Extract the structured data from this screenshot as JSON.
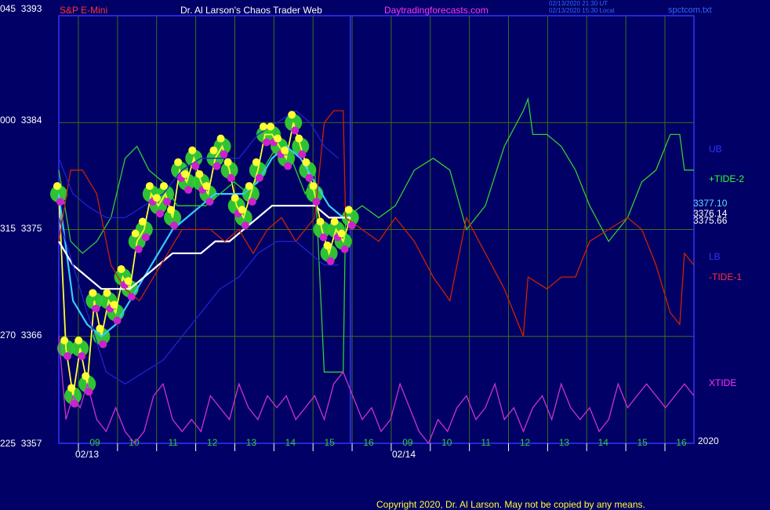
{
  "header": {
    "instrument": "S&P E-Mini",
    "title": "Dr. Al Larson's Chaos Trader Web",
    "site": "Daytradingforecasts.com",
    "stamp1": "02/13/2020 21:30 UT",
    "stamp2": "02/13/2020 15:30 Local",
    "file": "spctcom.txt"
  },
  "colors": {
    "background": "#000066",
    "grid": "#3c6e1e",
    "frame": "#3333ff",
    "price": "#ffff33",
    "ema_fast": "#33ccff",
    "ema_slow": "#ffffff",
    "tide_plus": "#33cc33",
    "tide_minus": "#cc2200",
    "xtide": "#cc33cc",
    "ub": "#2222cc",
    "lb": "#2222cc"
  },
  "right_labels": {
    "ub": "UB",
    "tide2": "+TIDE-2",
    "lb": "LB",
    "tide1": "-TIDE-1",
    "xtide": "XTIDE",
    "v1": "3377.10",
    "v2": "3376.14",
    "v3": "3375.66",
    "year": "2020"
  },
  "footer": {
    "copyright": "Copyright 2020, Dr. Al Larson. May not be copied by any means."
  },
  "chart_data": {
    "type": "line",
    "title": "S&P E-Mini",
    "y_ticks": [
      {
        "left": "045",
        "value": "3393"
      },
      {
        "left": "000",
        "value": "3384"
      },
      {
        "left": "315",
        "value": "3375"
      },
      {
        "left": "270",
        "value": "3366"
      },
      {
        "left": "225",
        "value": "3357"
      }
    ],
    "ylim": [
      3357,
      3393
    ],
    "x_ticks": [
      "09",
      "10",
      "11",
      "12",
      "13",
      "14",
      "15",
      "16",
      "09",
      "10",
      "11",
      "12",
      "13",
      "14",
      "15",
      "16"
    ],
    "date_labels": [
      "02/13",
      "02/14"
    ],
    "series": [
      {
        "name": "price",
        "color": "#ffff33",
        "points": [
          [
            0,
            3378
          ],
          [
            3,
            3365
          ],
          [
            6,
            3361
          ],
          [
            9,
            3365
          ],
          [
            12,
            3362
          ],
          [
            15,
            3369
          ],
          [
            18,
            3366
          ],
          [
            21,
            3369
          ],
          [
            24,
            3368
          ],
          [
            27,
            3371
          ],
          [
            30,
            3370
          ],
          [
            33,
            3374
          ],
          [
            36,
            3375
          ],
          [
            39,
            3378
          ],
          [
            42,
            3377
          ],
          [
            45,
            3378
          ],
          [
            48,
            3376
          ],
          [
            51,
            3380
          ],
          [
            54,
            3379
          ],
          [
            57,
            3381
          ],
          [
            60,
            3379
          ],
          [
            63,
            3378
          ],
          [
            66,
            3381
          ],
          [
            69,
            3382
          ],
          [
            72,
            3380
          ],
          [
            75,
            3377
          ],
          [
            78,
            3376
          ],
          [
            81,
            3378
          ],
          [
            84,
            3380
          ],
          [
            87,
            3383
          ],
          [
            90,
            3383
          ],
          [
            93,
            3382
          ],
          [
            96,
            3381
          ],
          [
            99,
            3384
          ],
          [
            102,
            3382
          ],
          [
            105,
            3380
          ],
          [
            108,
            3378
          ],
          [
            111,
            3375
          ],
          [
            114,
            3373
          ],
          [
            117,
            3375
          ],
          [
            120,
            3374
          ],
          [
            123,
            3376
          ]
        ]
      },
      {
        "name": "ema-fast",
        "color": "#33ccff",
        "points": [
          [
            0,
            3378
          ],
          [
            6,
            3369
          ],
          [
            12,
            3367
          ],
          [
            18,
            3366
          ],
          [
            24,
            3367
          ],
          [
            30,
            3369
          ],
          [
            36,
            3371
          ],
          [
            42,
            3373
          ],
          [
            48,
            3375
          ],
          [
            54,
            3376
          ],
          [
            60,
            3377
          ],
          [
            66,
            3378
          ],
          [
            72,
            3378
          ],
          [
            78,
            3378
          ],
          [
            84,
            3379
          ],
          [
            90,
            3381
          ],
          [
            96,
            3382
          ],
          [
            102,
            3381
          ],
          [
            108,
            3379
          ],
          [
            114,
            3377
          ],
          [
            120,
            3376
          ],
          [
            123,
            3376
          ]
        ]
      },
      {
        "name": "ema-slow",
        "color": "#ffffff",
        "points": [
          [
            0,
            3374
          ],
          [
            6,
            3372
          ],
          [
            12,
            3371
          ],
          [
            18,
            3370
          ],
          [
            24,
            3370
          ],
          [
            30,
            3370
          ],
          [
            36,
            3371
          ],
          [
            42,
            3372
          ],
          [
            48,
            3373
          ],
          [
            54,
            3373
          ],
          [
            60,
            3373
          ],
          [
            66,
            3374
          ],
          [
            72,
            3374
          ],
          [
            78,
            3375
          ],
          [
            84,
            3376
          ],
          [
            90,
            3377
          ],
          [
            96,
            3377
          ],
          [
            102,
            3377
          ],
          [
            108,
            3377
          ],
          [
            114,
            3376
          ],
          [
            120,
            3376
          ],
          [
            123,
            3376
          ]
        ]
      },
      {
        "name": "+TIDE-2",
        "color": "#33cc33",
        "points": [
          [
            0,
            3380
          ],
          [
            5,
            3374
          ],
          [
            10,
            3373
          ],
          [
            16,
            3374
          ],
          [
            22,
            3376
          ],
          [
            28,
            3381
          ],
          [
            33,
            3382
          ],
          [
            38,
            3380
          ],
          [
            44,
            3379
          ],
          [
            50,
            3377
          ],
          [
            56,
            3377
          ],
          [
            62,
            3377
          ],
          [
            68,
            3378
          ],
          [
            74,
            3379
          ],
          [
            80,
            3378
          ],
          [
            86,
            3380
          ],
          [
            92,
            3382
          ],
          [
            98,
            3381
          ],
          [
            104,
            3378
          ],
          [
            108,
            3380
          ],
          [
            112,
            3363
          ],
          [
            120,
            3363
          ],
          [
            121,
            3376
          ],
          [
            128,
            3377
          ],
          [
            135,
            3376
          ],
          [
            142,
            3377
          ],
          [
            150,
            3380
          ],
          [
            158,
            3381
          ],
          [
            165,
            3380
          ],
          [
            172,
            3375
          ],
          [
            180,
            3377
          ],
          [
            188,
            3382
          ],
          [
            196,
            3385
          ],
          [
            198,
            3386
          ],
          [
            200,
            3383
          ],
          [
            206,
            3383
          ],
          [
            212,
            3382
          ],
          [
            218,
            3380
          ],
          [
            224,
            3377
          ],
          [
            232,
            3374
          ],
          [
            240,
            3376
          ],
          [
            246,
            3379
          ],
          [
            252,
            3380
          ],
          [
            258,
            3383
          ],
          [
            262,
            3383
          ],
          [
            264,
            3380
          ],
          [
            268,
            3380
          ]
        ]
      },
      {
        "name": "-TIDE-1",
        "color": "#cc2200",
        "points": [
          [
            0,
            3374
          ],
          [
            5,
            3380
          ],
          [
            10,
            3380
          ],
          [
            16,
            3378
          ],
          [
            22,
            3372
          ],
          [
            28,
            3370
          ],
          [
            34,
            3369
          ],
          [
            40,
            3371
          ],
          [
            46,
            3373
          ],
          [
            52,
            3375
          ],
          [
            58,
            3375
          ],
          [
            64,
            3375
          ],
          [
            70,
            3374
          ],
          [
            76,
            3375
          ],
          [
            82,
            3373
          ],
          [
            88,
            3375
          ],
          [
            94,
            3376
          ],
          [
            100,
            3374
          ],
          [
            104,
            3375
          ],
          [
            108,
            3376
          ],
          [
            112,
            3384
          ],
          [
            116,
            3385
          ],
          [
            120,
            3385
          ],
          [
            121,
            3376
          ],
          [
            128,
            3375
          ],
          [
            135,
            3374
          ],
          [
            142,
            3376
          ],
          [
            150,
            3374
          ],
          [
            158,
            3371
          ],
          [
            165,
            3369
          ],
          [
            172,
            3376
          ],
          [
            180,
            3373
          ],
          [
            188,
            3370
          ],
          [
            196,
            3366
          ],
          [
            198,
            3371
          ],
          [
            206,
            3370
          ],
          [
            212,
            3371
          ],
          [
            218,
            3371
          ],
          [
            224,
            3374
          ],
          [
            232,
            3375
          ],
          [
            240,
            3376
          ],
          [
            246,
            3375
          ],
          [
            252,
            3372
          ],
          [
            258,
            3368
          ],
          [
            262,
            3367
          ],
          [
            264,
            3373
          ],
          [
            268,
            3372
          ]
        ]
      },
      {
        "name": "UB",
        "color": "#2222cc",
        "points": [
          [
            0,
            3381
          ],
          [
            6,
            3378
          ],
          [
            12,
            3377
          ],
          [
            20,
            3376
          ],
          [
            28,
            3376
          ],
          [
            36,
            3377
          ],
          [
            44,
            3378
          ],
          [
            52,
            3380
          ],
          [
            60,
            3381
          ],
          [
            68,
            3381
          ],
          [
            76,
            3381
          ],
          [
            84,
            3383
          ],
          [
            92,
            3384
          ],
          [
            100,
            3385
          ],
          [
            106,
            3384
          ],
          [
            112,
            3382
          ],
          [
            118,
            3381
          ]
        ]
      },
      {
        "name": "LB",
        "color": "#2222cc",
        "points": [
          [
            0,
            3376
          ],
          [
            6,
            3372
          ],
          [
            12,
            3368
          ],
          [
            20,
            3363
          ],
          [
            28,
            3362
          ],
          [
            36,
            3363
          ],
          [
            44,
            3364
          ],
          [
            52,
            3366
          ],
          [
            60,
            3368
          ],
          [
            68,
            3370
          ],
          [
            76,
            3371
          ],
          [
            84,
            3373
          ],
          [
            92,
            3374
          ],
          [
            100,
            3374
          ],
          [
            106,
            3373
          ],
          [
            112,
            3372
          ],
          [
            118,
            3372
          ]
        ]
      },
      {
        "name": "XTIDE",
        "color": "#cc33cc",
        "points": [
          [
            0,
            3366
          ],
          [
            3,
            3359
          ],
          [
            6,
            3361
          ],
          [
            9,
            3360
          ],
          [
            12,
            3362
          ],
          [
            16,
            3359
          ],
          [
            20,
            3358
          ],
          [
            24,
            3360
          ],
          [
            28,
            3358
          ],
          [
            32,
            3357
          ],
          [
            36,
            3358
          ],
          [
            40,
            3361
          ],
          [
            44,
            3362
          ],
          [
            48,
            3359
          ],
          [
            52,
            3358
          ],
          [
            56,
            3359
          ],
          [
            60,
            3358
          ],
          [
            64,
            3361
          ],
          [
            68,
            3360
          ],
          [
            72,
            3359
          ],
          [
            76,
            3362
          ],
          [
            80,
            3360
          ],
          [
            84,
            3359
          ],
          [
            88,
            3361
          ],
          [
            92,
            3360
          ],
          [
            96,
            3361
          ],
          [
            100,
            3359
          ],
          [
            104,
            3360
          ],
          [
            108,
            3361
          ],
          [
            112,
            3359
          ],
          [
            116,
            3362
          ],
          [
            120,
            3363
          ],
          [
            124,
            3361
          ],
          [
            128,
            3359
          ],
          [
            132,
            3360
          ],
          [
            136,
            3358
          ],
          [
            140,
            3359
          ],
          [
            144,
            3362
          ],
          [
            148,
            3360
          ],
          [
            152,
            3358
          ],
          [
            156,
            3357
          ],
          [
            160,
            3359
          ],
          [
            164,
            3358
          ],
          [
            168,
            3360
          ],
          [
            172,
            3361
          ],
          [
            176,
            3359
          ],
          [
            180,
            3360
          ],
          [
            184,
            3362
          ],
          [
            188,
            3359
          ],
          [
            192,
            3360
          ],
          [
            196,
            3358
          ],
          [
            200,
            3360
          ],
          [
            204,
            3361
          ],
          [
            208,
            3359
          ],
          [
            212,
            3362
          ],
          [
            216,
            3360
          ],
          [
            220,
            3359
          ],
          [
            224,
            3360
          ],
          [
            228,
            3358
          ],
          [
            232,
            3359
          ],
          [
            236,
            3362
          ],
          [
            240,
            3360
          ],
          [
            244,
            3361
          ],
          [
            248,
            3362
          ],
          [
            252,
            3361
          ],
          [
            256,
            3360
          ],
          [
            260,
            3361
          ],
          [
            264,
            3362
          ],
          [
            268,
            3361
          ]
        ]
      }
    ],
    "x_domain": [
      0,
      268
    ],
    "axis_note": "x index in 5-minute-ish bars; 123 bars on 02/13 session, projection to 02/14"
  }
}
